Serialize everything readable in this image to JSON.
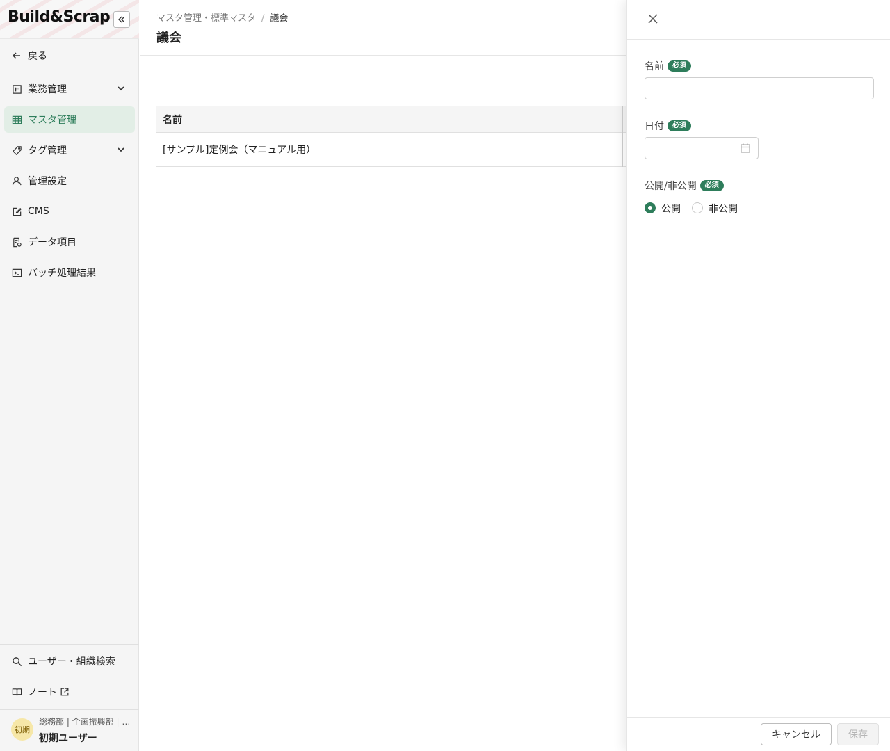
{
  "app": {
    "logo": "Build&Scrap",
    "collapse_icon": "double-chevron-left-icon"
  },
  "sidebar": {
    "back": "戻る",
    "items": [
      {
        "label": "業務管理",
        "icon": "task-icon",
        "expandable": true
      },
      {
        "label": "マスタ管理",
        "icon": "table-icon",
        "active": true
      },
      {
        "label": "タグ管理",
        "icon": "tag-icon",
        "expandable": true
      },
      {
        "label": "管理設定",
        "icon": "user-settings-icon"
      },
      {
        "label": "CMS",
        "icon": "edit-icon"
      },
      {
        "label": "データ項目",
        "icon": "data-item-icon"
      },
      {
        "label": "バッチ処理結果",
        "icon": "terminal-icon"
      }
    ],
    "bottom": [
      {
        "label": "ユーザー・組織検索",
        "icon": "search-icon"
      },
      {
        "label": "ノート",
        "icon": "book-icon"
      }
    ],
    "user": {
      "avatar": "初期",
      "org": "総務部 | 企画振興部 | …",
      "name": "初期ユーザー"
    }
  },
  "header": {
    "breadcrumb": [
      "マスタ管理・標準マスタ",
      "議会"
    ],
    "breadcrumb_sep": "/",
    "title": "議会"
  },
  "table": {
    "columns": [
      "名前"
    ],
    "rows": [
      [
        "[サンプル]定例会（マニュアル用）"
      ]
    ]
  },
  "drawer": {
    "fields": {
      "name": {
        "label": "名前",
        "required": "必須",
        "value": ""
      },
      "date": {
        "label": "日付",
        "required": "必須",
        "value": ""
      },
      "visibility": {
        "label": "公開/非公開",
        "required": "必須",
        "options": [
          "公開",
          "非公開"
        ],
        "selected": "公開"
      }
    },
    "cancel": "キャンセル",
    "save": "保存"
  },
  "colors": {
    "accent": "#2e7d5b",
    "active_bg": "#e2eee6"
  }
}
